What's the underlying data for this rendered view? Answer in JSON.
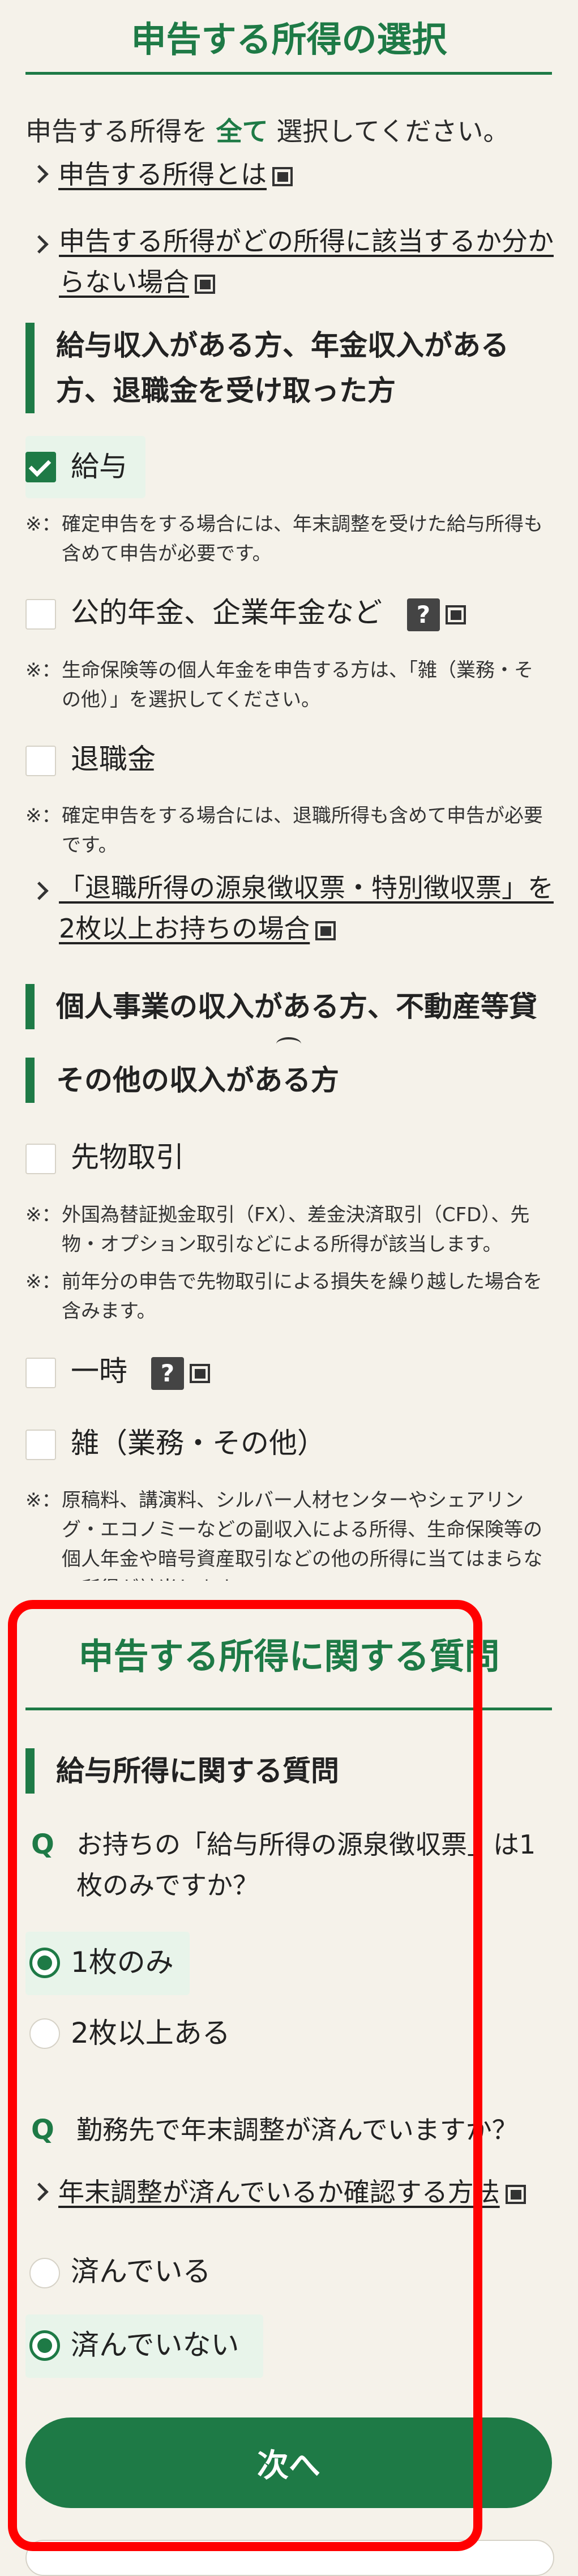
{
  "section1": {
    "title": "申告する所得の選択",
    "intro_prefix": "申告する所得を",
    "intro_emphasis": "全て",
    "intro_suffix": "選択してください。",
    "links": [
      "申告する所得とは",
      "申告する所得がどの所得に該当するか分からない場合"
    ]
  },
  "group1": {
    "heading": "給与収入がある方、年金収入がある方、退職金を受け取った方",
    "options": [
      {
        "label": "給与",
        "checked": true,
        "note": "確定申告をする場合には、年末調整を受けた給与所得も含めて申告が必要です。"
      },
      {
        "label": "公的年金、企業年金など",
        "checked": false,
        "help": "?",
        "note": "生命保険等の個人年金を申告する方は、「雑（業務・その他）」を選択してください。"
      },
      {
        "label": "退職金",
        "checked": false,
        "note": "確定申告をする場合には、退職所得も含めて申告が必要です。"
      }
    ],
    "retire_link": "「退職所得の源泉徴収票・特別徴収票」を2枚以上お持ちの場合"
  },
  "group2": {
    "heading": "個人事業の収入がある方、不動産等貸"
  },
  "group3": {
    "heading": "その他の収入がある方",
    "futures_label": "先物取引",
    "futures_notes": [
      "外国為替証拠金取引（FX）、差金決済取引（CFD）、先物・オプション取引などによる所得が該当します。",
      "前年分の申告で先物取引による損失を繰り越した場合を含みます。"
    ],
    "ichiji_label": "一時",
    "help": "?",
    "misc_label": "雑（業務・その他）",
    "misc_note": "原稿料、講演料、シルバー人材センターやシェアリング・エコノミーなどの副収入による所得、生命保険等の個人年金や暗号資産取引などの他の所得に当てはまらない所得が該当します。",
    "note_mark": "※："
  },
  "section2": {
    "title": "申告する所得に関する質問",
    "heading": "給与所得に関する質問",
    "q_mark": "Q",
    "q1": "お持ちの「給与所得の源泉徴収票」は1枚のみですか？",
    "q1_options": [
      {
        "label": "1枚のみ",
        "selected": true
      },
      {
        "label": "2枚以上ある",
        "selected": false
      }
    ],
    "q2": "勤務先で年末調整が済んでいますか？",
    "q2_link": "年末調整が済んでいるか確認する方法",
    "q2_options": [
      {
        "label": "済んでいる",
        "selected": false
      },
      {
        "label": "済んでいない",
        "selected": true
      }
    ]
  },
  "next_button": "次へ",
  "colors": {
    "accent": "#1e7a46",
    "annotation": "#ff0000",
    "background": "#f5f2ea"
  }
}
